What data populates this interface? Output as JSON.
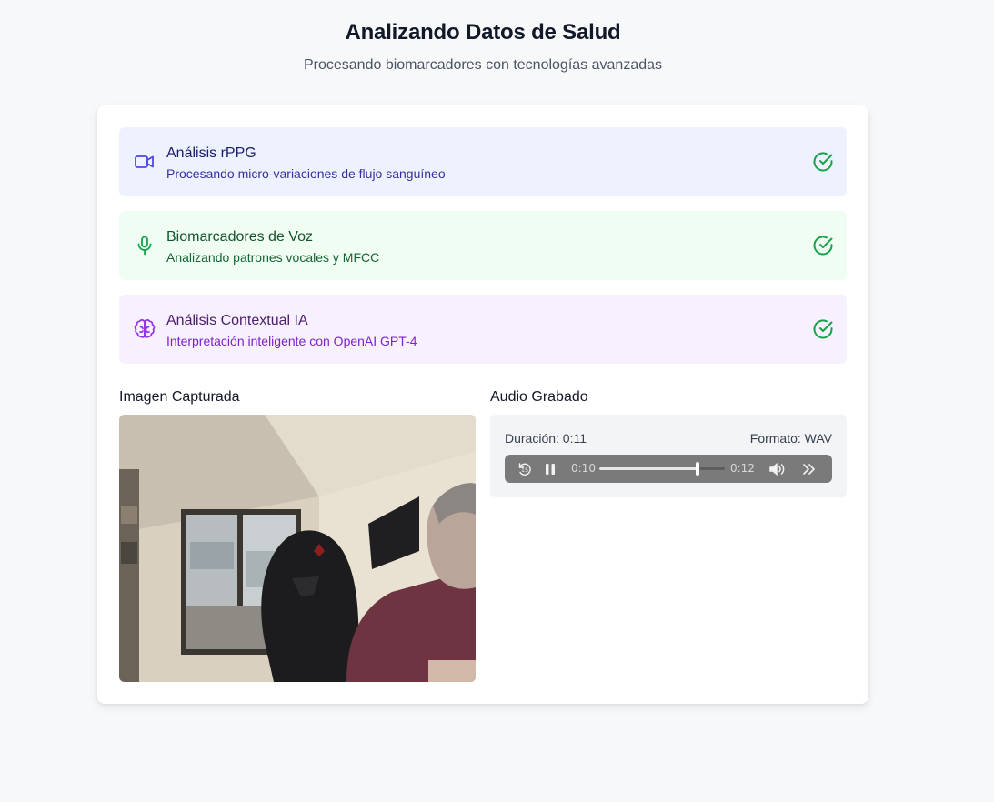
{
  "header": {
    "title": "Analizando Datos de Salud",
    "subtitle": "Procesando biomarcadores con tecnologías avanzadas"
  },
  "steps": [
    {
      "icon": "video-camera-icon",
      "label": "Análisis rPPG",
      "description": "Procesando micro-variaciones de flujo sanguíneo",
      "status": "complete",
      "accent": "#4f46e5"
    },
    {
      "icon": "microphone-icon",
      "label": "Biomarcadores de Voz",
      "description": "Analizando patrones vocales y MFCC",
      "status": "complete",
      "accent": "#16a34a"
    },
    {
      "icon": "brain-icon",
      "label": "Análisis Contextual IA",
      "description": "Interpretación inteligente con OpenAI GPT-4",
      "status": "complete",
      "accent": "#9333ea"
    }
  ],
  "image_section": {
    "title": "Imagen Capturada"
  },
  "audio_section": {
    "title": "Audio Grabado",
    "duration_label": "Duración: 0:11",
    "format_label": "Formato: WAV",
    "player": {
      "current_time": "0:10",
      "total_time": "0:12",
      "progress_fraction": 0.78,
      "state": "playing"
    }
  },
  "colors": {
    "check": "#16a34a",
    "page_bg": "#f7f8fa"
  }
}
